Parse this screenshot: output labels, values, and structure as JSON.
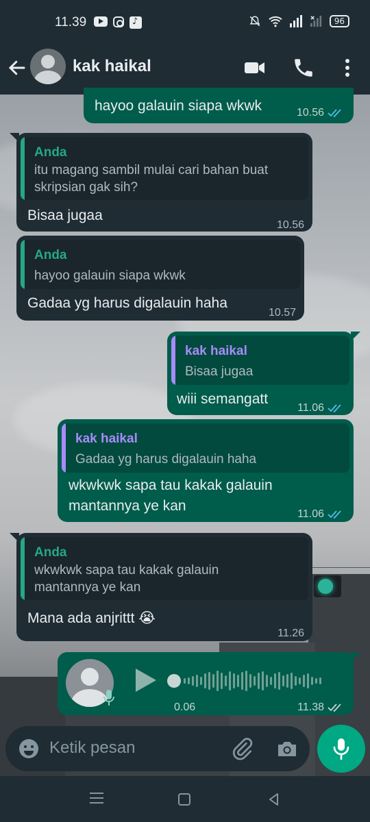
{
  "status_bar": {
    "time": "11.39",
    "battery": "96",
    "icons_left": [
      "youtube-icon",
      "instagram-icon",
      "tiktok-icon"
    ],
    "icons_right": [
      "bell-mute-icon",
      "wifi-icon",
      "signal-icon",
      "signal-x-icon"
    ]
  },
  "header": {
    "contact_name": "kak haikal",
    "icons": [
      "back-arrow-icon",
      "avatar",
      "video-call-icon",
      "voice-call-icon",
      "more-vert-icon"
    ]
  },
  "messages": [
    {
      "direction": "out",
      "text": "hayoo galauin siapa wkwk",
      "time": "10.56",
      "read": true
    },
    {
      "direction": "in",
      "quote_author": "Anda",
      "quote_text": "itu magang sambil mulai cari bahan buat skripsian gak sih?",
      "text": "Bisaa jugaa",
      "time": "10.56"
    },
    {
      "direction": "in",
      "quote_author": "Anda",
      "quote_text": "hayoo galauin siapa wkwk",
      "text": "Gadaa yg harus digalauin haha",
      "time": "10.57"
    },
    {
      "direction": "out",
      "quote_author": "kak haikal",
      "quote_text": "Bisaa jugaa",
      "text": "wiii semangatt",
      "time": "11.06",
      "read": true
    },
    {
      "direction": "out",
      "quote_author": "kak haikal",
      "quote_text": "Gadaa yg harus digalauin haha",
      "text": "wkwkwk sapa tau kakak galauin mantannya ye kan",
      "time": "11.06",
      "read": true
    },
    {
      "direction": "in",
      "quote_author": "Anda",
      "quote_text": "wkwkwk sapa tau kakak galauin mantannya ye kan",
      "text": "Mana ada anjrittt 😭",
      "time": "11.26"
    }
  ],
  "voice_note": {
    "duration": "0.06",
    "time": "11.38",
    "read": true
  },
  "composer": {
    "placeholder": "Ketik pesan"
  },
  "colors": {
    "bar_bg": "#1f2c34",
    "incoming_bubble": "#1f2c34",
    "outgoing_bubble": "#005c4b",
    "accent": "#00a884",
    "quote_self": "#25a884",
    "quote_contact": "#a78bfa",
    "read_tick": "#53bdeb"
  }
}
